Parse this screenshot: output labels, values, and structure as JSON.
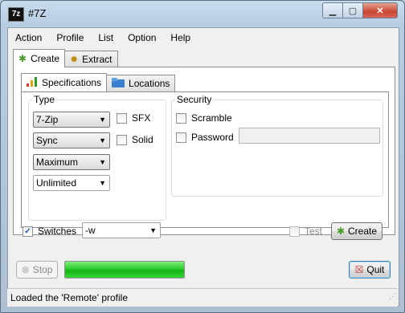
{
  "window": {
    "title": "#7Z",
    "app_icon": "7z"
  },
  "menu": [
    "Action",
    "Profile",
    "List",
    "Option",
    "Help"
  ],
  "outer_tabs": {
    "create": "Create",
    "extract": "Extract"
  },
  "inner_tabs": {
    "specifications": "Specifications",
    "locations": "Locations"
  },
  "type_group": {
    "legend": "Type",
    "format": "7-Zip",
    "mode": "Sync",
    "level": "Maximum",
    "volume": "Unlimited",
    "sfx": {
      "label": "SFX",
      "checked": false
    },
    "solid": {
      "label": "Solid",
      "checked": false
    }
  },
  "security_group": {
    "legend": "Security",
    "scramble": {
      "label": "Scramble",
      "checked": false
    },
    "password": {
      "label": "Password",
      "checked": false,
      "value": ""
    }
  },
  "switches": {
    "label": "Switches",
    "checked": true,
    "value": "-w"
  },
  "test": {
    "label": "Test",
    "checked": false
  },
  "buttons": {
    "create": "Create",
    "stop": "Stop",
    "quit": "Quit"
  },
  "progress": {
    "fraction": 1.0
  },
  "status": "Loaded the 'Remote' profile",
  "colors": {
    "progress": "#22c322",
    "close_button": "#c8452f",
    "check_mark": "#1b4f9c"
  }
}
